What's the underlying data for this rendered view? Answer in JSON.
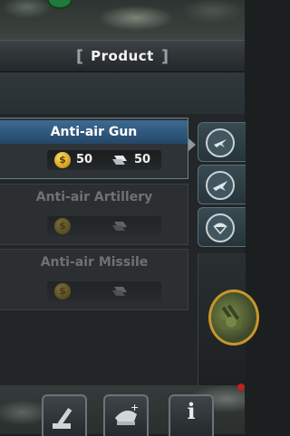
{
  "header": {
    "title": "Product",
    "bracket_left": "[",
    "bracket_right": "]"
  },
  "products": [
    {
      "name": "Anti-air Gun",
      "gold": "50",
      "metal": "50",
      "selected": true
    },
    {
      "name": "Anti-air Artillery",
      "gold": "",
      "metal": "",
      "selected": false
    },
    {
      "name": "Anti-air Missile",
      "gold": "",
      "metal": "",
      "selected": false
    }
  ],
  "side_tabs": [
    {
      "icon": "plane-emblem-icon"
    },
    {
      "icon": "jet-emblem-icon"
    },
    {
      "icon": "paratrooper-emblem-icon"
    }
  ],
  "bottom_bar": [
    {
      "icon": "anti-air-cannon-icon"
    },
    {
      "icon": "officer-cap-add-icon"
    },
    {
      "icon": "info-icon",
      "label": "i"
    }
  ],
  "colors": {
    "gold": "#e0a81a",
    "selected_header": "#2f5a80"
  }
}
